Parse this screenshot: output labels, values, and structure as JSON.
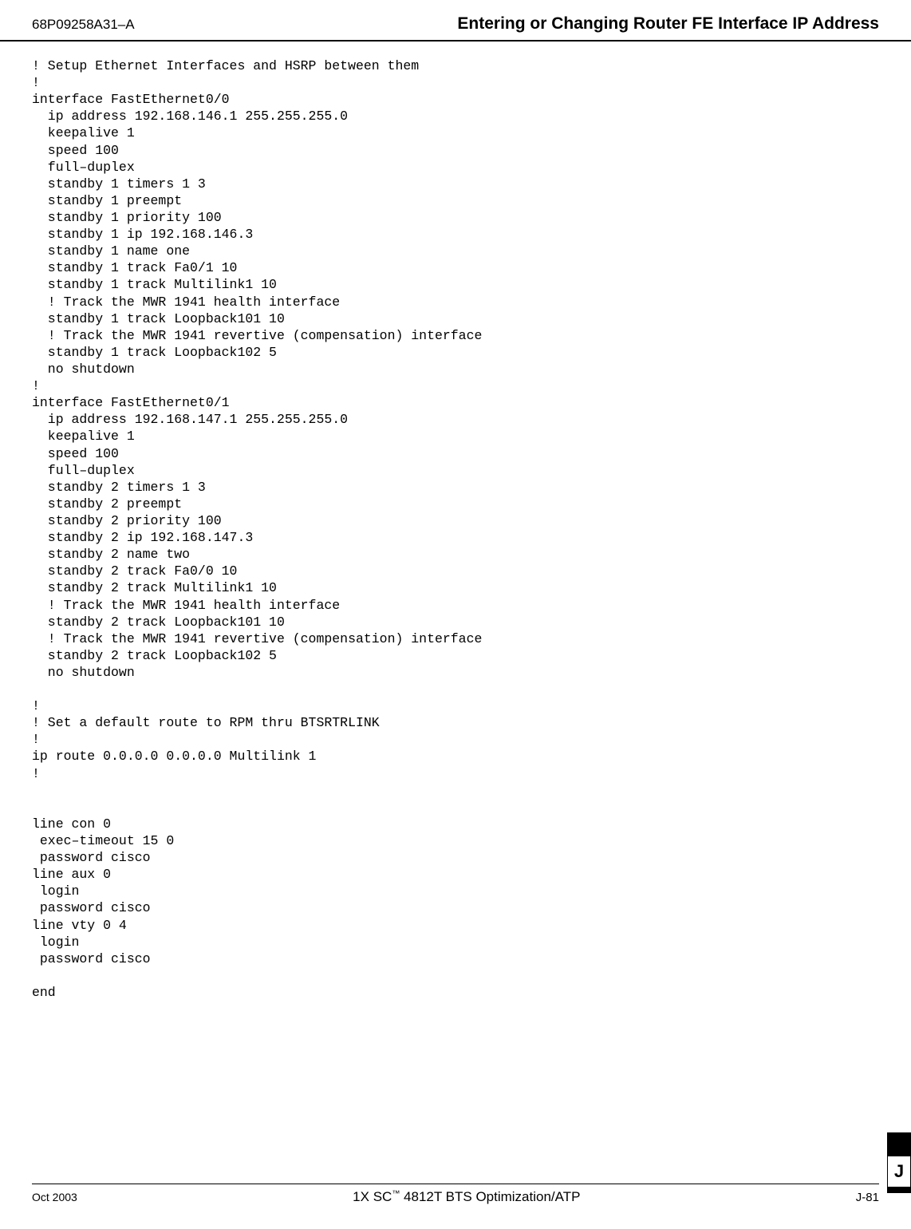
{
  "header": {
    "doc_number": "68P09258A31–A",
    "title": "Entering or Changing Router FE Interface IP Address"
  },
  "code": "! Setup Ethernet Interfaces and HSRP between them\n!\ninterface FastEthernet0/0\n  ip address 192.168.146.1 255.255.255.0\n  keepalive 1\n  speed 100\n  full–duplex\n  standby 1 timers 1 3\n  standby 1 preempt\n  standby 1 priority 100\n  standby 1 ip 192.168.146.3\n  standby 1 name one\n  standby 1 track Fa0/1 10\n  standby 1 track Multilink1 10\n  ! Track the MWR 1941 health interface\n  standby 1 track Loopback101 10\n  ! Track the MWR 1941 revertive (compensation) interface\n  standby 1 track Loopback102 5\n  no shutdown\n!\ninterface FastEthernet0/1\n  ip address 192.168.147.1 255.255.255.0\n  keepalive 1\n  speed 100\n  full–duplex\n  standby 2 timers 1 3\n  standby 2 preempt\n  standby 2 priority 100\n  standby 2 ip 192.168.147.3\n  standby 2 name two\n  standby 2 track Fa0/0 10\n  standby 2 track Multilink1 10\n  ! Track the MWR 1941 health interface\n  standby 2 track Loopback101 10\n  ! Track the MWR 1941 revertive (compensation) interface\n  standby 2 track Loopback102 5\n  no shutdown\n\n!\n! Set a default route to RPM thru BTSRTRLINK\n!\nip route 0.0.0.0 0.0.0.0 Multilink 1\n!\n\n\nline con 0\n exec–timeout 15 0\n password cisco\nline aux 0\n login\n password cisco\nline vty 0 4\n login\n password cisco\n\nend",
  "footer": {
    "date": "Oct 2003",
    "center_prefix": "1X SC",
    "center_suffix": " 4812T BTS Optimization/ATP",
    "page": "J-81",
    "tab_letter": "J"
  }
}
